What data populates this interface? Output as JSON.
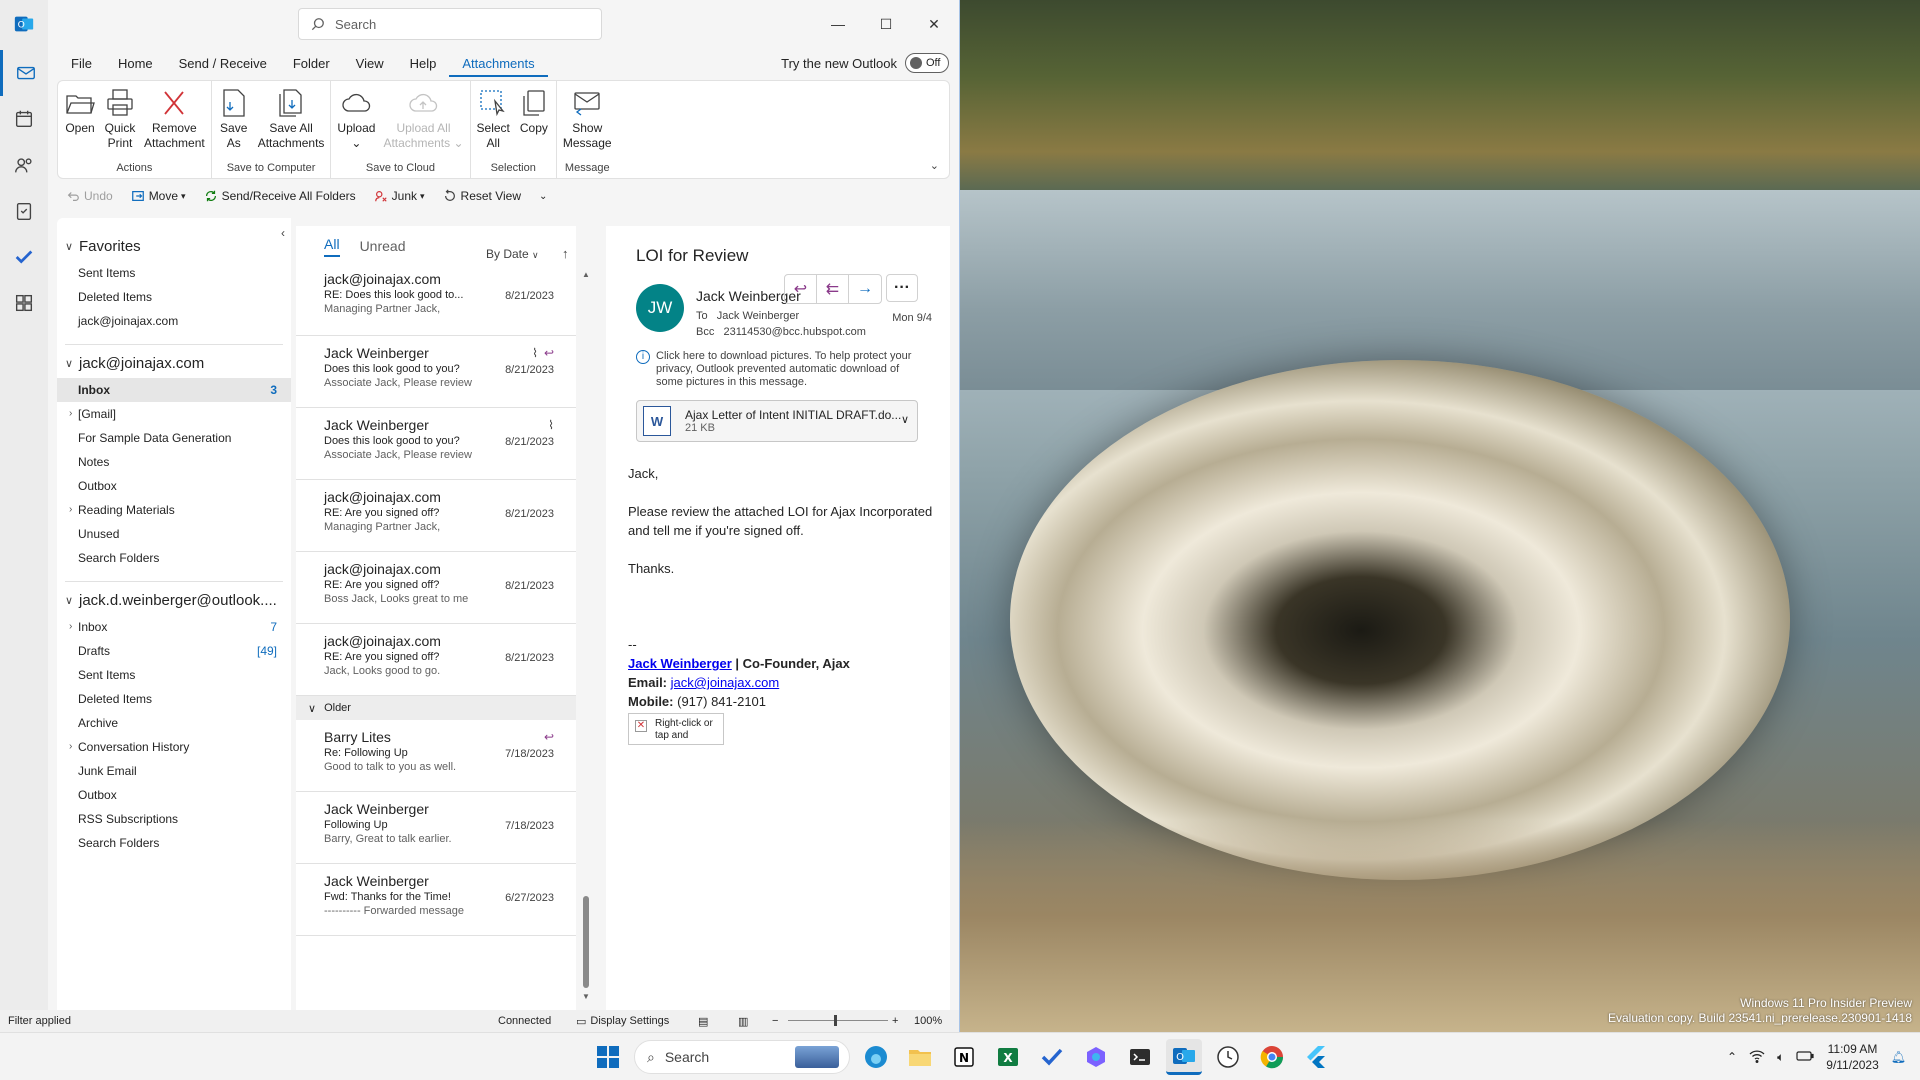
{
  "titlebar": {
    "search_placeholder": "Search",
    "minimize": "—",
    "maximize": "☐",
    "close": "✕"
  },
  "menu": {
    "items": [
      "File",
      "Home",
      "Send / Receive",
      "Folder",
      "View",
      "Help",
      "Attachments"
    ],
    "active": "Attachments",
    "try_new": "Try the new Outlook",
    "toggle_state": "Off"
  },
  "ribbon": {
    "groups": [
      {
        "label": "Actions",
        "buttons": [
          {
            "line1": "Open",
            "line2": ""
          },
          {
            "line1": "Quick",
            "line2": "Print"
          },
          {
            "line1": "Remove",
            "line2": "Attachment"
          }
        ]
      },
      {
        "label": "Save to Computer",
        "buttons": [
          {
            "line1": "Save",
            "line2": "As"
          },
          {
            "line1": "Save All",
            "line2": "Attachments"
          }
        ]
      },
      {
        "label": "Save to Cloud",
        "buttons": [
          {
            "line1": "Upload",
            "line2": "⌄"
          },
          {
            "line1": "Upload All",
            "line2": "Attachments ⌄"
          }
        ]
      },
      {
        "label": "Selection",
        "buttons": [
          {
            "line1": "Select",
            "line2": "All"
          },
          {
            "line1": "Copy",
            "line2": ""
          }
        ]
      },
      {
        "label": "Message",
        "buttons": [
          {
            "line1": "Show",
            "line2": "Message"
          }
        ]
      }
    ]
  },
  "qat": {
    "undo": "Undo",
    "move": "Move",
    "sendreceive": "Send/Receive All Folders",
    "junk": "Junk",
    "reset": "Reset View"
  },
  "folders": {
    "favorites_label": "Favorites",
    "favorites": [
      "Sent Items",
      "Deleted Items",
      "jack@joinajax.com"
    ],
    "account1_label": "jack@joinajax.com",
    "account1": [
      {
        "name": "Inbox",
        "count": "3"
      },
      {
        "name": "[Gmail]",
        "count": ""
      },
      {
        "name": "For Sample Data Generation",
        "count": ""
      },
      {
        "name": "Notes",
        "count": ""
      },
      {
        "name": "Outbox",
        "count": ""
      },
      {
        "name": "Reading Materials",
        "count": ""
      },
      {
        "name": "Unused",
        "count": ""
      },
      {
        "name": "Search Folders",
        "count": ""
      }
    ],
    "account2_label": "jack.d.weinberger@outlook....",
    "account2": [
      {
        "name": "Inbox",
        "count": "7"
      },
      {
        "name": "Drafts",
        "count": "[49]"
      },
      {
        "name": "Sent Items",
        "count": ""
      },
      {
        "name": "Deleted Items",
        "count": ""
      },
      {
        "name": "Archive",
        "count": ""
      },
      {
        "name": "Conversation History",
        "count": ""
      },
      {
        "name": "Junk Email",
        "count": ""
      },
      {
        "name": "Outbox",
        "count": ""
      },
      {
        "name": "RSS Subscriptions",
        "count": ""
      },
      {
        "name": "Search Folders",
        "count": ""
      }
    ]
  },
  "list": {
    "tab_all": "All",
    "tab_unread": "Unread",
    "sort": "By Date",
    "messages": [
      {
        "from": "jack@joinajax.com",
        "subject": "RE: Does this look good to...",
        "preview": "Managing Partner Jack,",
        "date": "8/21/2023"
      },
      {
        "from": "Jack Weinberger",
        "subject": "Does this look good to you?",
        "preview": "Associate Jack,  Please review",
        "date": "8/21/2023"
      },
      {
        "from": "Jack Weinberger",
        "subject": "Does this look good to you?",
        "preview": "Associate Jack,  Please review",
        "date": "8/21/2023"
      },
      {
        "from": "jack@joinajax.com",
        "subject": "RE: Are you signed off?",
        "preview": "Managing Partner Jack,",
        "date": "8/21/2023"
      },
      {
        "from": "jack@joinajax.com",
        "subject": "RE: Are you signed off?",
        "preview": "Boss Jack,  Looks great to me",
        "date": "8/21/2023"
      },
      {
        "from": "jack@joinajax.com",
        "subject": "RE: Are you signed off?",
        "preview": "Jack,  Looks good to go.",
        "date": "8/21/2023"
      }
    ],
    "older_label": "Older",
    "older": [
      {
        "from": "Barry Lites",
        "subject": "Re: Following Up",
        "preview": "Good to talk to you as well.",
        "date": "7/18/2023"
      },
      {
        "from": "Jack Weinberger",
        "subject": "Following Up",
        "preview": "Barry,  Great to talk earlier.",
        "date": "7/18/2023"
      },
      {
        "from": "Jack Weinberger",
        "subject": "Fwd: Thanks for the Time!",
        "preview": "---------- Forwarded message",
        "date": "6/27/2023"
      }
    ]
  },
  "reading": {
    "subject": "LOI for Review",
    "avatar": "JW",
    "sender": "Jack Weinberger",
    "to_label": "To",
    "to": "Jack Weinberger",
    "date": "Mon 9/4",
    "bcc_label": "Bcc",
    "bcc": "23114530@bcc.hubspot.com",
    "info": "Click here to download pictures. To help protect your privacy, Outlook prevented automatic download of some pictures in this message.",
    "attachment_name": "Ajax Letter of Intent INITIAL DRAFT.do...",
    "attachment_size": "21 KB",
    "greeting": "Jack,",
    "body": "Please review the attached LOI for Ajax Incorporated and tell me if you're signed off.",
    "closing": "Thanks.",
    "sig_dash": "--",
    "sig_name": "Jack Weinberger",
    "sig_title": " | Co-Founder, Ajax",
    "sig_email_label": "Email: ",
    "sig_email": "jack@joinajax.com",
    "sig_mobile_label": "Mobile: ",
    "sig_mobile": "(917) 841-2101",
    "img_placeholder": "Right-click or tap and"
  },
  "status": {
    "filter": "Filter applied",
    "connected": "Connected",
    "display": "Display Settings",
    "zoom": "100%"
  },
  "desktop": {
    "watermark_line1": "Windows 11 Pro Insider Preview",
    "watermark_line2": "Evaluation copy. Build 23541.ni_prerelease.230901-1418"
  },
  "taskbar": {
    "search": "Search",
    "time": "11:09 AM",
    "date": "9/11/2023"
  }
}
